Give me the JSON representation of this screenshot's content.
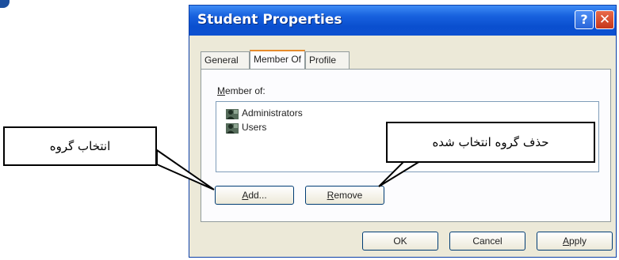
{
  "dialog": {
    "title": "Student Properties",
    "help_label": "?",
    "close_label": "✕",
    "tabs": [
      {
        "label": "General"
      },
      {
        "label": "Member Of"
      },
      {
        "label": "Profile"
      }
    ],
    "member_of_label_first": "M",
    "member_of_label_rest": "ember of:",
    "groups": [
      {
        "name": "Administrators",
        "icon": "group-icon"
      },
      {
        "name": "Users",
        "icon": "group-icon"
      }
    ],
    "add_button": {
      "u": "A",
      "rest": "dd..."
    },
    "remove_button": {
      "u": "R",
      "rest": "emove"
    },
    "ok_button": "OK",
    "cancel_button": "Cancel",
    "apply_button": {
      "u": "A",
      "rest": "pply"
    }
  },
  "annotations": {
    "left": "انتخاب گروه",
    "right": "حذف گروه انتخاب شده"
  },
  "colors": {
    "titlebar": "#0a4fcf",
    "dialog_bg": "#ece9d8",
    "active_tab_accent": "#e68b2c"
  }
}
